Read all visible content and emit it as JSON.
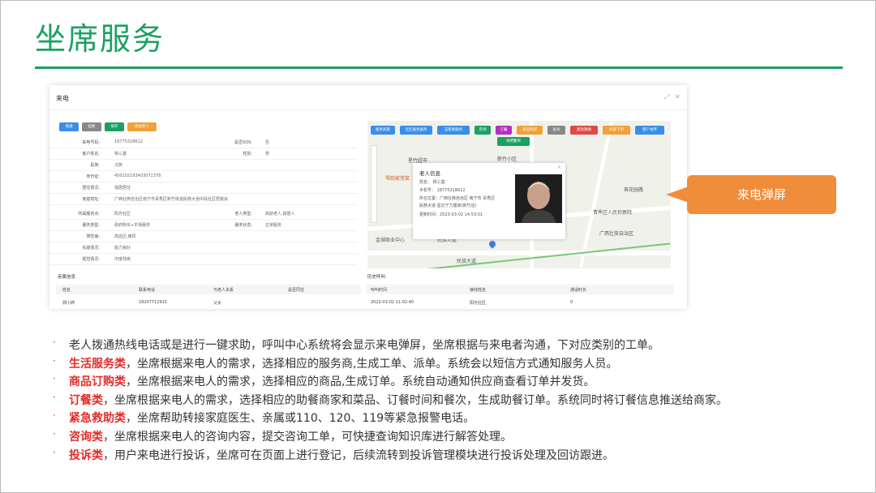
{
  "slide": {
    "title": "坐席服务"
  },
  "window": {
    "title": "来电",
    "toolbar": [
      {
        "label": "接通",
        "color": "#3a8ee6"
      },
      {
        "label": "挂断",
        "color": "#888888"
      },
      {
        "label": "保存",
        "color": "#1aa162"
      },
      {
        "label": "添加老人",
        "color": "#f0a13a"
      }
    ],
    "form": {
      "phone": {
        "label": "来电号码:",
        "value": "18775318612"
      },
      "sos": {
        "label": "是否SOS:",
        "value": "否"
      },
      "name": {
        "label": "客户姓名:",
        "value": "杨三基"
      },
      "gender": {
        "label": "性别:",
        "value": "男"
      },
      "ethnic": {
        "label": "民族:",
        "value": "汉族"
      },
      "idcard": {
        "label": "身份证:",
        "value": "450102193403071378"
      },
      "living": {
        "label": "居住情况:",
        "value": "独居居住"
      },
      "address": {
        "label": "家庭地址:",
        "value": "广西壮族自治区南宁市青秀区新竹街道民族大道中段社区居委会"
      },
      "community": {
        "label": "所属服务点:",
        "value": "阳光社区"
      },
      "elder_type": {
        "label": "老人类型:",
        "value": "高龄老人,独居人"
      },
      "service_type": {
        "label": "服务类型:",
        "value": "政府购买+市场服务"
      },
      "service_status": {
        "label": "服务状态:",
        "value": "正常服务"
      },
      "chronic": {
        "label": "慢性病:",
        "value": "高血压,痛风"
      },
      "disability": {
        "label": "失能情况:",
        "value": "能力良好"
      },
      "vision": {
        "label": "视觉情况:",
        "value": "中度残疾"
      }
    },
    "relatives": {
      "title": "亲属信息",
      "headers": [
        "姓名",
        "联系电话",
        "与老人关系",
        "是否同住"
      ],
      "rows": [
        [
          "郭小婷",
          "18207712915",
          "父女",
          ""
        ]
      ]
    },
    "history": {
      "title": "历史呼叫",
      "headers": [
        "呼叫时间",
        "接线姓名",
        "通话时长"
      ],
      "rows": [
        [
          "2023-03-02 11:02:40",
          "阳光社区",
          "0"
        ]
      ]
    },
    "map": {
      "buttons": [
        {
          "label": "服务商家",
          "color": "#3a8ee6"
        },
        {
          "label": "社区服务服务",
          "color": "#3a8ee6"
        },
        {
          "label": "志愿者服务",
          "color": "#3a8ee6"
        },
        {
          "label": "咨询",
          "color": "#1aa162"
        },
        {
          "label": "订餐",
          "color": "#b030c0"
        },
        {
          "label": "商品购买",
          "color": "#f0a13a"
        },
        {
          "label": "投诉",
          "color": "#888888"
        },
        {
          "label": "紧急救助",
          "color": "#e04848"
        },
        {
          "label": "外部下单",
          "color": "#f0a13a"
        },
        {
          "label": "客户关怀",
          "color": "#3a8ee6"
        }
      ],
      "sub_button": {
        "label": "待把警单",
        "color": "#1aa162"
      },
      "places": [
        "星竹超市",
        "新竹小区",
        "琴韵家常菜",
        "金湖商业中心",
        "民族大道",
        "青秀区人民检察院",
        "广西壮族自治区",
        "茶花园路",
        "民族大道"
      ],
      "popup": {
        "title": "老人信息",
        "name": "姓名：    杨三基",
        "mobile": "手机号：  18775318612",
        "addr1": "所在位置：广西壮族自治区 南宁市 青秀区",
        "addr2": "民族大道 星近宁力膳家(新竹店)",
        "updated": "更新时间：2023-03-02 14:53:01"
      }
    }
  },
  "callout": "来电弹屏",
  "bullets": [
    {
      "key": "",
      "text": "老人拨通热线电话或是进行一键求助，呼叫中心系统将会显示来电弹屏，坐席根据与来电者沟通，下对应类别的工单。"
    },
    {
      "key": "生活服务类",
      "text": "，坐席根据来电人的需求，选择相应的服务商,生成工单、派单。系统会以短信方式通知服务人员。"
    },
    {
      "key": "商品订购类",
      "text": "，坐席根据来电人的需求，选择相应的商品,生成订单。系统自动通知供应商查看订单并发货。"
    },
    {
      "key": "订餐类",
      "text": "，坐席根据来电人的需求，选择相应的助餐商家和菜品、订餐时间和餐次，生成助餐订单。系统同时将订餐信息推送给商家。"
    },
    {
      "key": "紧急救助类",
      "text": "，坐席帮助转接家庭医生、亲属或110、120、119等紧急报警电话。"
    },
    {
      "key": "咨询类",
      "text": "，坐席根据来电人的咨询内容，提交咨询工单，可快捷查询知识库进行解答处理。"
    },
    {
      "key": "投诉类",
      "text": "，用户来电进行投诉，坐席可在页面上进行登记，后续流转到投诉管理模块进行投诉处理及回访跟进。"
    }
  ]
}
